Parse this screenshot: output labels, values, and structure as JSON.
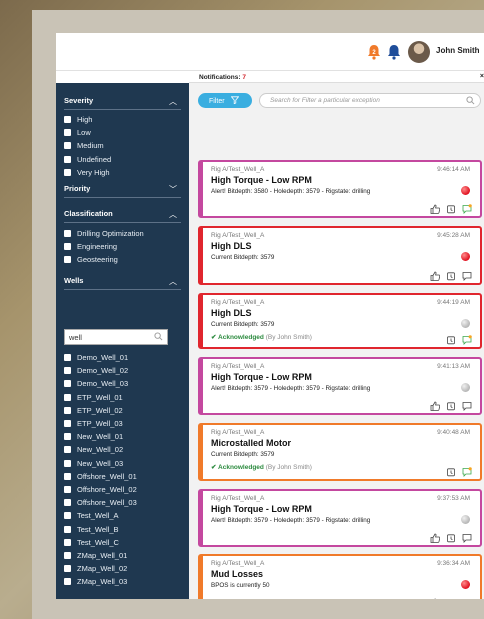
{
  "header": {
    "user_name": "John Smith",
    "alert_badge": "2",
    "icons": [
      "alert-bell-icon",
      "notification-bell-icon",
      "user-avatar"
    ]
  },
  "notifications": {
    "label": "Notifications:",
    "count": "7",
    "close": "×"
  },
  "toolbar": {
    "filter_label": "Filter",
    "search_placeholder": "Search for Filter a particular exception"
  },
  "sidebar": {
    "severity": {
      "title": "Severity",
      "options": [
        "High",
        "Low",
        "Medium",
        "Undefined",
        "Very High"
      ]
    },
    "priority": {
      "title": "Priority"
    },
    "classification": {
      "title": "Classification",
      "options": [
        "Drilling Optimization",
        "Engineering",
        "Geosteering"
      ]
    },
    "wells": {
      "title": "Wells",
      "search_value": "well",
      "options": [
        "Demo_Well_01",
        "Demo_Well_02",
        "Demo_Well_03",
        "ETP_Well_01",
        "ETP_Well_02",
        "ETP_Well_03",
        "New_Well_01",
        "New_Well_02",
        "New_Well_03",
        "Offshore_Well_01",
        "Offshore_Well_02",
        "Offshore_Well_03",
        "Test_Well_A",
        "Test_Well_B",
        "Test_Well_C",
        "ZMap_Well_01",
        "ZMap_Well_02",
        "ZMap_Well_03"
      ]
    }
  },
  "cards": [
    {
      "rig": "Rig A/Test_Well_A",
      "time": "9:46:14 AM",
      "title": "High Torque - Low RPM",
      "detail": "Alert! Bitdepth: 3580 - Holedepth: 3579 - Rigstate: drilling",
      "ack": "",
      "ack_by": "",
      "color": "#c4489f",
      "status": "red"
    },
    {
      "rig": "Rig A/Test_Well_A",
      "time": "9:45:28 AM",
      "title": "High DLS",
      "detail": "Current Bitdepth: 3579",
      "ack": "",
      "ack_by": "",
      "color": "#e0262e",
      "status": "red"
    },
    {
      "rig": "Rig A/Test_Well_A",
      "time": "9:44:19 AM",
      "title": "High DLS",
      "detail": "Current Bitdepth: 3579",
      "ack": "Acknowledged",
      "ack_by": "(By John Smith)",
      "color": "#e0262e",
      "status": "gray"
    },
    {
      "rig": "Rig A/Test_Well_A",
      "time": "9:41:13 AM",
      "title": "High Torque - Low RPM",
      "detail": "Alert! Bitdepth: 3579 - Holedepth: 3579 - Rigstate: drilling",
      "ack": "",
      "ack_by": "",
      "color": "#c4489f",
      "status": "gray"
    },
    {
      "rig": "Rig A/Test_Well_A",
      "time": "9:40:48 AM",
      "title": "Microstalled Motor",
      "detail": "Current Bitdepth: 3579",
      "ack": "Acknowledged",
      "ack_by": "(By John Smith)",
      "color": "#f07a2a",
      "status": "none"
    },
    {
      "rig": "Rig A/Test_Well_A",
      "time": "9:37:53 AM",
      "title": "High Torque - Low RPM",
      "detail": "Alert! Bitdepth: 3579 - Holedepth: 3579 - Rigstate: drilling",
      "ack": "",
      "ack_by": "",
      "color": "#c4489f",
      "status": "gray"
    },
    {
      "rig": "Rig A/Test_Well_A",
      "time": "9:36:34 AM",
      "title": "Mud Losses",
      "detail": "BPOS is currently 50",
      "ack": "",
      "ack_by": "",
      "color": "#f07a2a",
      "status": "red"
    }
  ]
}
